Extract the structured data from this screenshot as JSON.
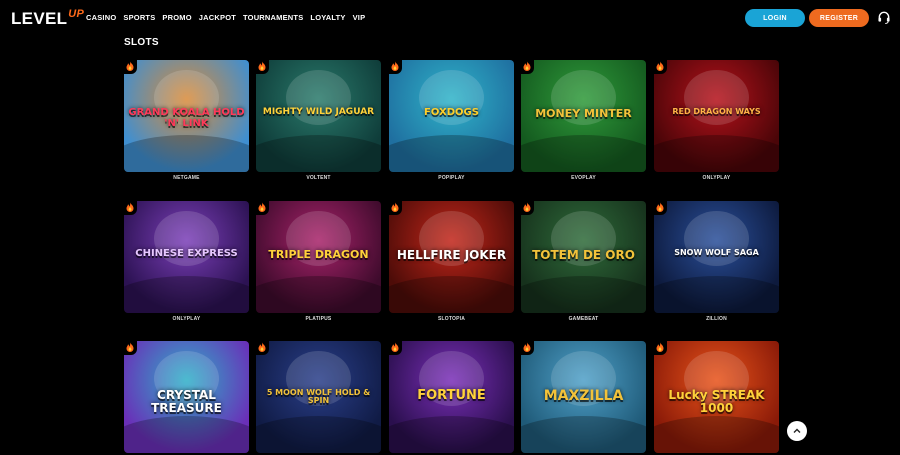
{
  "header": {
    "logo_text": "LEVEL",
    "logo_up": "UP",
    "nav": [
      "CASINO",
      "SPORTS",
      "PROMO",
      "JACKPOT",
      "TOURNAMENTS",
      "LOYALTY",
      "VIP"
    ],
    "login_label": "LOGIN",
    "register_label": "REGISTER",
    "support_icon": "headset-icon"
  },
  "section": {
    "title": "SLOTS"
  },
  "games": [
    {
      "title": "GRAND KOALA HOLD 'N' LINK",
      "provider": "NETGAME",
      "bg": "#d98b3a",
      "bg2": "#3f8fd1",
      "color": "#ff3a5a"
    },
    {
      "title": "MIGHTY WILD JAGUAR",
      "provider": "VOLTENT",
      "bg": "#2a7a6b",
      "bg2": "#0f3d3a",
      "color": "#ffd23a"
    },
    {
      "title": "FOXDOGS",
      "provider": "POPIPLAY",
      "bg": "#2fb3c8",
      "bg2": "#1f6fa0",
      "color": "#ffcf2a"
    },
    {
      "title": "MONEY MINTER",
      "provider": "EVOPLAY",
      "bg": "#2f9a3a",
      "bg2": "#145a1f",
      "color": "#f2c23a"
    },
    {
      "title": "RED DRAGON WAYS",
      "provider": "ONLYPLAY",
      "bg": "#b5121b",
      "bg2": "#4a0508",
      "color": "#ffb347"
    },
    {
      "title": "CHINESE EXPRESS",
      "provider": "ONLYPLAY",
      "bg": "#7b3fb8",
      "bg2": "#2c1253",
      "color": "#e7c7ff"
    },
    {
      "title": "TRIPLE DRAGON",
      "provider": "PLATIPUS",
      "bg": "#a8236a",
      "bg2": "#3e0b2c",
      "color": "#ffd23a"
    },
    {
      "title": "HELLFIRE JOKER",
      "provider": "SLOTOPIA",
      "bg": "#c2261a",
      "bg2": "#4d0c08",
      "color": "#ffffff"
    },
    {
      "title": "TOTEM DE ORO",
      "provider": "GAMEBEAT",
      "bg": "#2f6b3a",
      "bg2": "#16311c",
      "color": "#f2c23a"
    },
    {
      "title": "SNOW WOLF SAGA",
      "provider": "ZILLION",
      "bg": "#2a4f9a",
      "bg2": "#0d1a3d",
      "color": "#ffffff"
    },
    {
      "title": "CRYSTAL TREASURE",
      "provider": "",
      "bg": "#2fb0c8",
      "bg2": "#6a2fb8",
      "color": "#ffffff"
    },
    {
      "title": "5 MOON WOLF HOLD & SPIN",
      "provider": "",
      "bg": "#2a3f8a",
      "bg2": "#101b45",
      "color": "#f2c23a"
    },
    {
      "title": "FORTUNE",
      "provider": "",
      "bg": "#7a2fb8",
      "bg2": "#2a0f4d",
      "color": "#ffd23a"
    },
    {
      "title": "MAXZILLA",
      "provider": "",
      "bg": "#4fa0c8",
      "bg2": "#1f5a78",
      "color": "#f2c23a"
    },
    {
      "title": "Lucky STREAK 1000",
      "provider": "",
      "bg": "#e8531a",
      "bg2": "#8a1a08",
      "color": "#ffd23a"
    }
  ],
  "scroll_top_icon": "chevron-up-icon"
}
